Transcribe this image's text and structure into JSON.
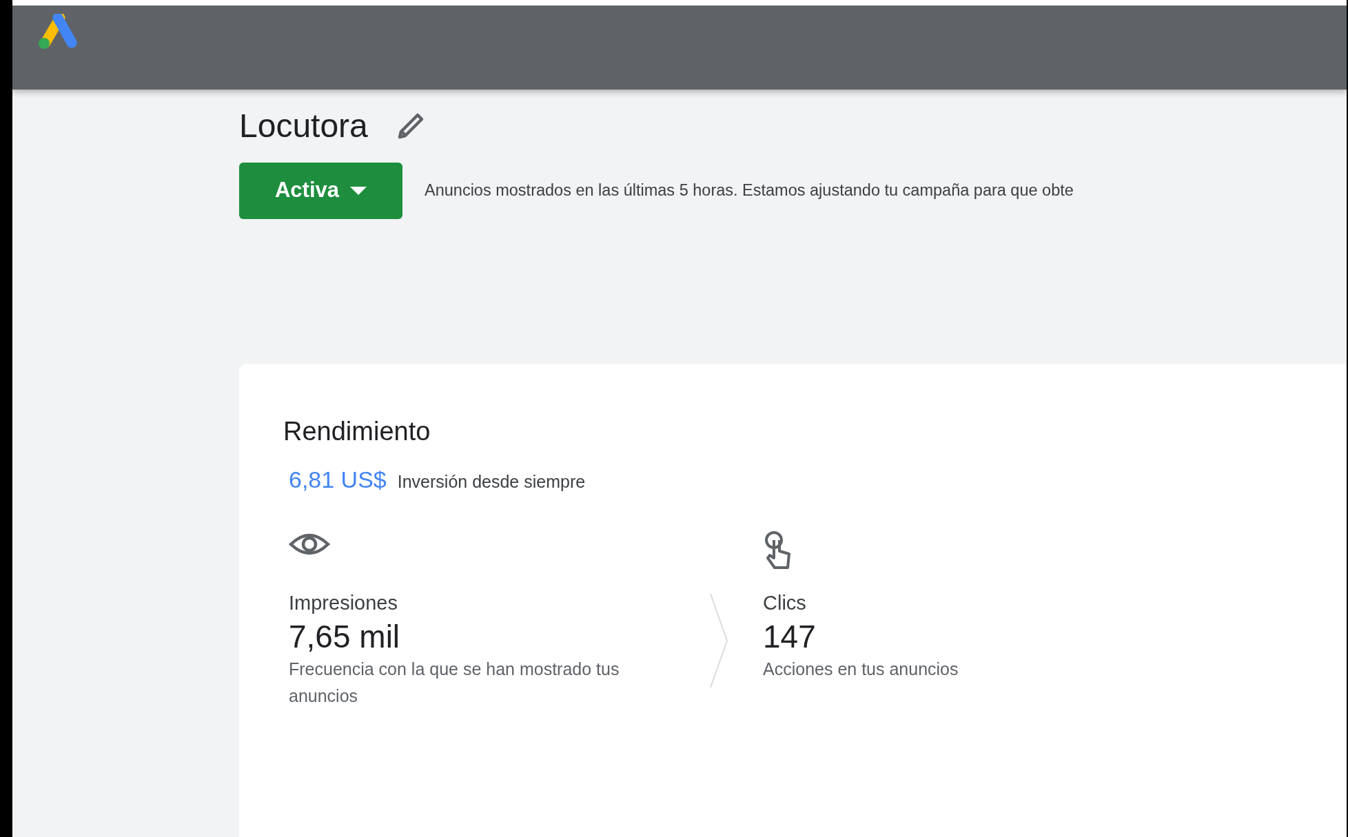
{
  "campaign": {
    "title": "Locutora",
    "status": "Activa",
    "message": "Anuncios mostrados en las últimas 5 horas. Estamos ajustando tu campaña para que obte"
  },
  "performance": {
    "title": "Rendimiento",
    "spend": "6,81 US$",
    "spend_label": "Inversión desde siempre",
    "metrics": [
      {
        "kind": "impressions",
        "label": "Impresiones",
        "value": "7,65 mil",
        "description": "Frecuencia con la que se han mostrado tus anuncios"
      },
      {
        "kind": "clicks",
        "label": "Clics",
        "value": "147",
        "description": "Acciones en tus anuncios"
      }
    ]
  }
}
